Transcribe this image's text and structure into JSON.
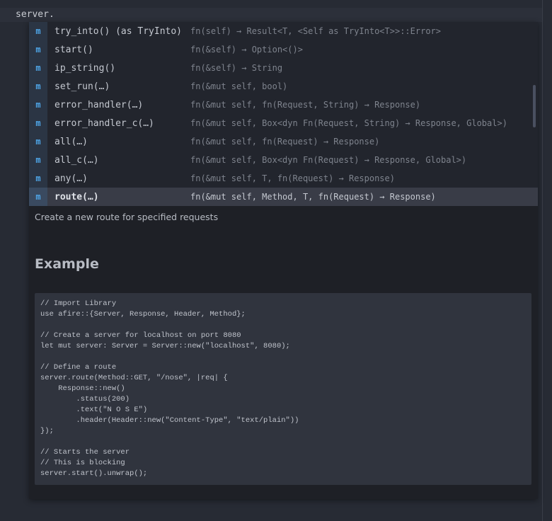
{
  "editor": {
    "text": "server."
  },
  "completion": {
    "kind_icon": "m",
    "items": [
      {
        "label": "try_into() (as TryInto)",
        "detail": "fn(self) → Result<T, <Self as TryInto<T>>::Error>"
      },
      {
        "label": "start()",
        "detail": "fn(&self) → Option<()>"
      },
      {
        "label": "ip_string()",
        "detail": "fn(&self) → String"
      },
      {
        "label": "set_run(…)",
        "detail": "fn(&mut self, bool)"
      },
      {
        "label": "error_handler(…)",
        "detail": "fn(&mut self, fn(Request, String) → Response)"
      },
      {
        "label": "error_handler_c(…)",
        "detail": "fn(&mut self, Box<dyn Fn(Request, String) → Response, Global>)"
      },
      {
        "label": "all(…)",
        "detail": "fn(&mut self, fn(Request) → Response)"
      },
      {
        "label": "all_c(…)",
        "detail": "fn(&mut self, Box<dyn Fn(Request) → Response, Global>)"
      },
      {
        "label": "any(…)",
        "detail": "fn(&mut self, T, fn(Request) → Response)"
      },
      {
        "label": "route(…)",
        "detail": "fn(&mut self, Method, T, fn(Request) → Response)",
        "selected": true
      }
    ]
  },
  "doc": {
    "description": "Create a new route for specified requests",
    "heading": "Example",
    "code": "// Import Library\nuse afire::{Server, Response, Header, Method};\n\n// Create a server for localhost on port 8080\nlet mut server: Server = Server::new(\"localhost\", 8080);\n\n// Define a route\nserver.route(Method::GET, \"/nose\", |req| {\n    Response::new()\n        .status(200)\n        .text(\"N O S E\")\n        .header(Header::new(\"Content-Type\", \"text/plain\"))\n});\n\n// Starts the server\n// This is blocking\nserver.start().unwrap();"
  }
}
